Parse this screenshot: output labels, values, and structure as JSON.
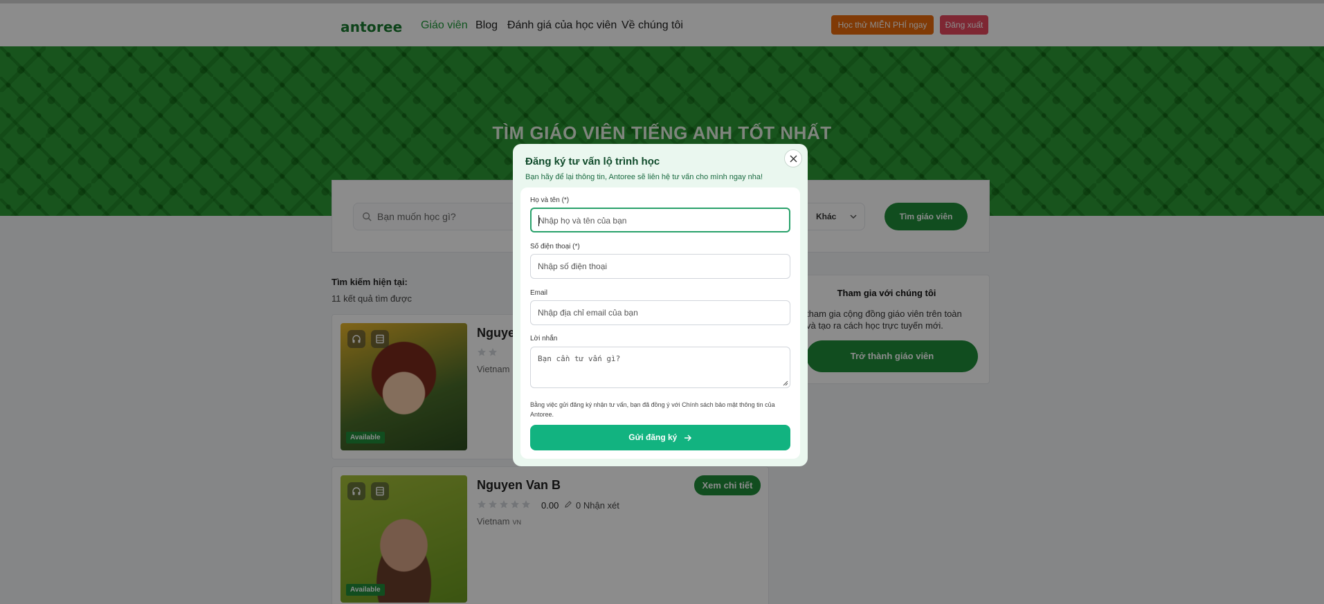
{
  "nav": {
    "logo": "antoree",
    "links": [
      "Giáo viên",
      "Blog",
      "Đánh giá của học viên",
      "Về chúng tôi"
    ],
    "trial_button": "Học thử MIỄN PHÍ ngay",
    "logout_button": "Đăng xuất"
  },
  "hero": {
    "title": "TÌM GIÁO VIÊN TIẾNG ANH TỐT NHẤT"
  },
  "search": {
    "placeholder": "Bạn muốn học gì?",
    "other_select": "Khác",
    "find_button": "Tìm giáo viên"
  },
  "results": {
    "current_label": "Tìm kiếm hiện tại:",
    "count_text": "11 kết quả tìm được"
  },
  "teachers": [
    {
      "name": "Nguyen",
      "rating": "",
      "reviews": "",
      "country": "Vietnam",
      "country_code": "",
      "available": "Available",
      "detail": ""
    },
    {
      "name": "Nguyen Van B",
      "rating": "0.00",
      "reviews": "0 Nhận xét",
      "country": "Vietnam",
      "country_code": "VN",
      "available": "Available",
      "detail": "Xem chi tiết"
    }
  ],
  "join": {
    "title": "Tham gia với chúng tôi",
    "desc": "tham gia cộng đồng giáo viên trên toàn và tạo ra cách học trực tuyến mới.",
    "button": "Trở thành giáo viên"
  },
  "modal": {
    "title": "Đăng ký tư vấn lộ trình học",
    "subtitle": "Bạn hãy để lại thông tin, Antoree sẽ liên hệ tư vấn cho mình ngay nha!",
    "fields": {
      "name_label": "Họ và tên (*)",
      "name_placeholder": "Nhập họ và tên của bạn",
      "phone_label": "Số điện thoại (*)",
      "phone_placeholder": "Nhập số điện thoại",
      "email_label": "Email",
      "email_placeholder": "Nhập địa chỉ email của bạn",
      "message_label": "Lời nhắn",
      "message_placeholder": "Bạn cần tư vấn gì?"
    },
    "consent": "Bằng việc gửi đăng ký nhận tư vấn, bạn đã đồng ý với Chính sách bảo mật thông tin của Antoree.",
    "submit": "Gửi đăng ký"
  }
}
